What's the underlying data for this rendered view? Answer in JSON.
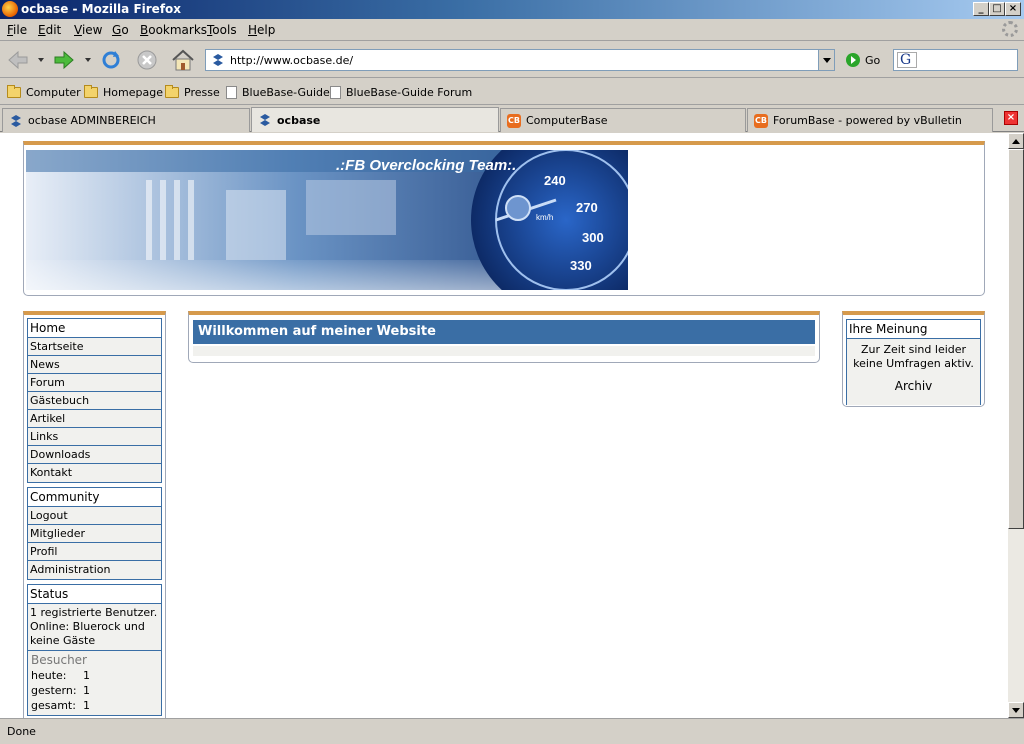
{
  "window": {
    "title": "ocbase - Mozilla Firefox"
  },
  "menubar": [
    {
      "label": "File",
      "u": "F"
    },
    {
      "label": "Edit",
      "u": "E"
    },
    {
      "label": "View",
      "u": "V"
    },
    {
      "label": "Go",
      "u": "G"
    },
    {
      "label": "Bookmarks",
      "u": "B"
    },
    {
      "label": "Tools",
      "u": "T"
    },
    {
      "label": "Help",
      "u": "H"
    }
  ],
  "nav": {
    "url": "http://www.ocbase.de/",
    "go_label": "Go",
    "search_value": ""
  },
  "bookmarks": [
    {
      "label": "Computer",
      "type": "folder"
    },
    {
      "label": "Homepage",
      "type": "folder"
    },
    {
      "label": "Presse",
      "type": "folder"
    },
    {
      "label": "BlueBase-Guide",
      "type": "page"
    },
    {
      "label": "BlueBase-Guide Forum",
      "type": "page"
    }
  ],
  "tabs": [
    {
      "label": "ocbase ADMINBEREICH",
      "active": false,
      "icon": "ocbase-icon"
    },
    {
      "label": "ocbase",
      "active": true,
      "icon": "ocbase-icon"
    },
    {
      "label": "ComputerBase",
      "active": false,
      "icon": "computerbase-icon"
    },
    {
      "label": "ForumBase - powered by vBulletin",
      "active": false,
      "icon": "computerbase-icon"
    }
  ],
  "banner": {
    "text": ".:FB Overclocking Team:.",
    "speeds": [
      "240",
      "270",
      "300",
      "330"
    ],
    "unit": "km/h"
  },
  "sidebar": {
    "home": {
      "title": "Home",
      "items": [
        "Startseite",
        "News",
        "Forum",
        "Gästebuch",
        "Artikel",
        "Links",
        "Downloads",
        "Kontakt"
      ]
    },
    "community": {
      "title": "Community",
      "items": [
        "Logout",
        "Mitglieder",
        "Profil",
        "Administration"
      ]
    },
    "status": {
      "title": "Status",
      "lines": [
        "1 registrierte Benutzer.",
        "Online: Bluerock und keine Gäste"
      ],
      "visitors": {
        "title": "Besucher",
        "rows": [
          {
            "label": "heute:",
            "value": "1"
          },
          {
            "label": "gestern:",
            "value": "1"
          },
          {
            "label": "gesamt:",
            "value": "1"
          }
        ]
      }
    }
  },
  "main": {
    "welcome": "Willkommen auf meiner Website"
  },
  "poll": {
    "title": "Ihre Meinung",
    "text": "Zur Zeit sind leider keine Umfragen aktiv.",
    "archive_label": "Archiv"
  },
  "statusbar": {
    "text": "Done"
  },
  "colors": {
    "accent": "#3a6ea5",
    "border_top": "#d69a4c",
    "item_bg": "#f1f1ee"
  }
}
